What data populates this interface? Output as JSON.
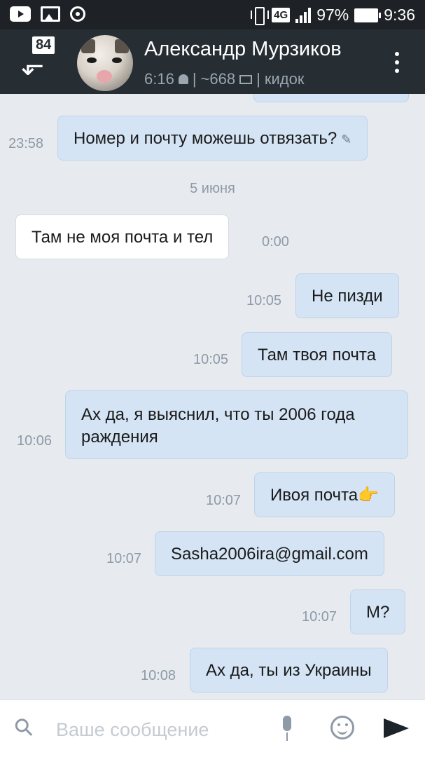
{
  "status_bar": {
    "network": "4G",
    "battery": "97%",
    "time": "9:36"
  },
  "header": {
    "unread_count": "84",
    "contact_name": "Александр Мурзиков",
    "last_seen": "6:16",
    "followers": "~668",
    "status_text": "кидок"
  },
  "chat": {
    "date_separator": "5 июня",
    "messages": [
      {
        "text": "Номер и почту можешь отвязать?",
        "time": "23:58",
        "direction": "out",
        "edited": true
      },
      {
        "text": "Там не моя почта и тел",
        "time": "0:00",
        "direction": "in"
      },
      {
        "text": "Не пизди",
        "time": "10:05",
        "direction": "out"
      },
      {
        "text": "Там твоя почта",
        "time": "10:05",
        "direction": "out"
      },
      {
        "text": "Ах да, я выяснил, что ты 2006 года",
        "text2": "раждения",
        "time": "10:06",
        "direction": "out"
      },
      {
        "text": "Ивоя почта",
        "emoji": "👉",
        "time": "10:07",
        "direction": "out"
      },
      {
        "text": "Sasha2006ira@gmail.com",
        "time": "10:07",
        "direction": "out"
      },
      {
        "text": "М?",
        "time": "10:07",
        "direction": "out"
      },
      {
        "text": "Ах да, ты из Украины",
        "time": "10:08",
        "direction": "out"
      }
    ]
  },
  "input": {
    "placeholder": "Ваше сообщение"
  },
  "icons": {
    "attach": "paperclip-icon",
    "mic": "microphone-icon",
    "emoji": "smiley-icon",
    "send": "send-icon"
  }
}
